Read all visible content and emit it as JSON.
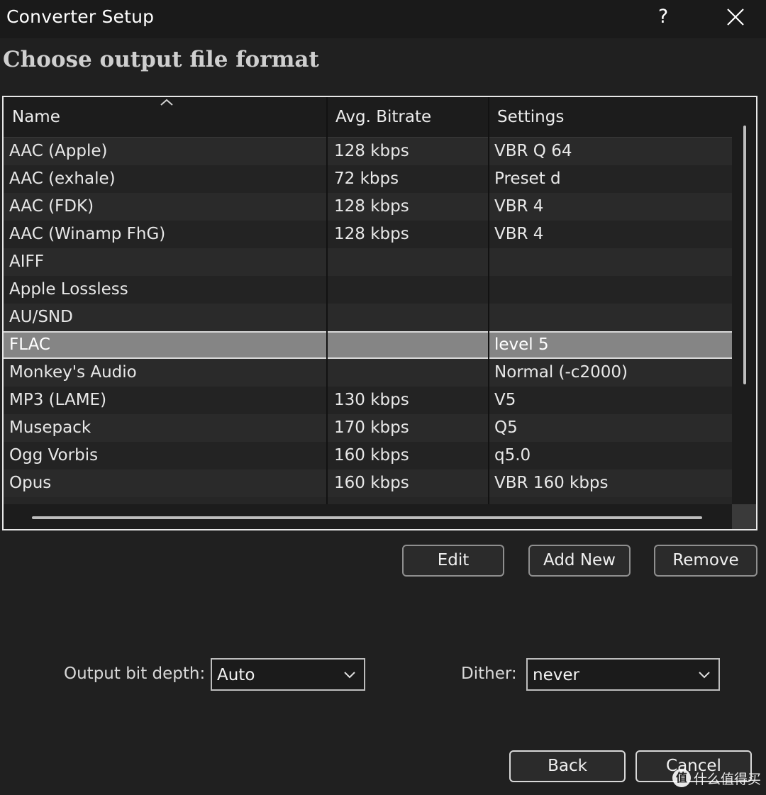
{
  "window": {
    "title": "Converter Setup",
    "help_label": "?"
  },
  "heading": "Choose output file format",
  "table": {
    "columns": [
      "Name",
      "Avg. Bitrate",
      "Settings"
    ],
    "rows": [
      {
        "name": "AAC (Apple)",
        "bitrate": "128 kbps",
        "settings": "VBR Q 64"
      },
      {
        "name": "AAC (exhale)",
        "bitrate": "72 kbps",
        "settings": "Preset d"
      },
      {
        "name": "AAC (FDK)",
        "bitrate": "128 kbps",
        "settings": "VBR 4"
      },
      {
        "name": "AAC (Winamp FhG)",
        "bitrate": "128 kbps",
        "settings": "VBR 4"
      },
      {
        "name": "AIFF",
        "bitrate": "",
        "settings": ""
      },
      {
        "name": "Apple Lossless",
        "bitrate": "",
        "settings": ""
      },
      {
        "name": "AU/SND",
        "bitrate": "",
        "settings": ""
      },
      {
        "name": "FLAC",
        "bitrate": "",
        "settings": "level 5",
        "selected": true
      },
      {
        "name": "Monkey's Audio",
        "bitrate": "",
        "settings": "Normal (-c2000)"
      },
      {
        "name": "MP3 (LAME)",
        "bitrate": "130 kbps",
        "settings": "V5"
      },
      {
        "name": "Musepack",
        "bitrate": "170 kbps",
        "settings": "Q5"
      },
      {
        "name": "Ogg Vorbis",
        "bitrate": "160 kbps",
        "settings": "q5.0"
      },
      {
        "name": "Opus",
        "bitrate": "160 kbps",
        "settings": "VBR 160 kbps"
      }
    ]
  },
  "buttons": {
    "edit": "Edit",
    "add_new": "Add New",
    "remove": "Remove",
    "back": "Back",
    "cancel": "Cancel"
  },
  "output_bit_depth": {
    "label": "Output bit depth:",
    "value": "Auto"
  },
  "dither": {
    "label": "Dither:",
    "value": "never"
  },
  "watermark": {
    "badge": "值",
    "text": "什么值得买"
  },
  "colors": {
    "background": "#202020",
    "selected_row": "#858585",
    "border": "#e8e8e8"
  }
}
